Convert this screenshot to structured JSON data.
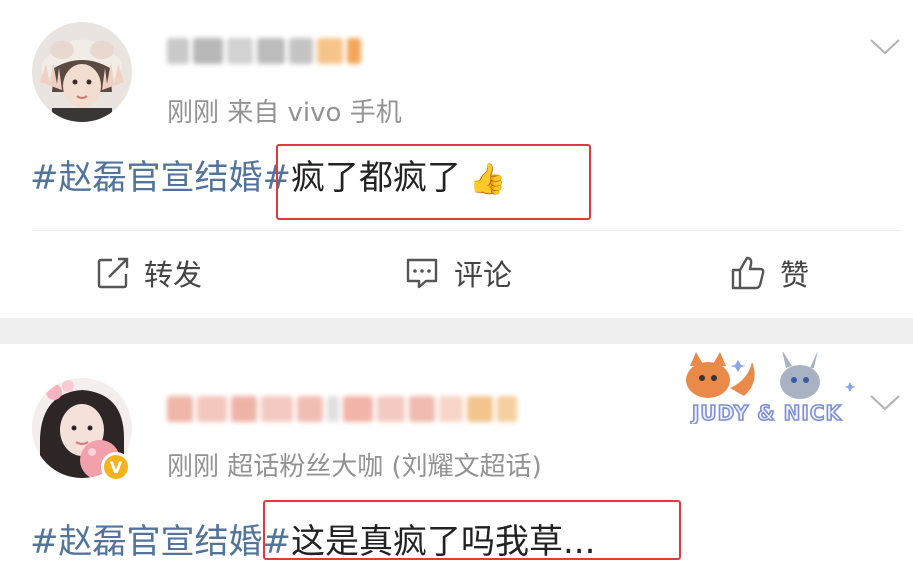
{
  "colors": {
    "topic": "#52749c",
    "highlight_box": "#e23a3a",
    "meta_text": "#939393",
    "verified_badge": "#f6b320"
  },
  "post1": {
    "meta": "刚刚  来自 vivo 手机",
    "topic": "#赵磊官宣结婚#",
    "text": "疯了都疯了",
    "emoji": "👍",
    "actions": {
      "repost": "转发",
      "comment": "评论",
      "like": "赞"
    }
  },
  "post2": {
    "meta": "刚刚  超话粉丝大咖 (刘耀文超话)",
    "topic": "#赵磊官宣结婚#",
    "text": "这是真疯了吗我草...",
    "sticker_text": "JUDY & NICK",
    "badge_text": "V"
  }
}
